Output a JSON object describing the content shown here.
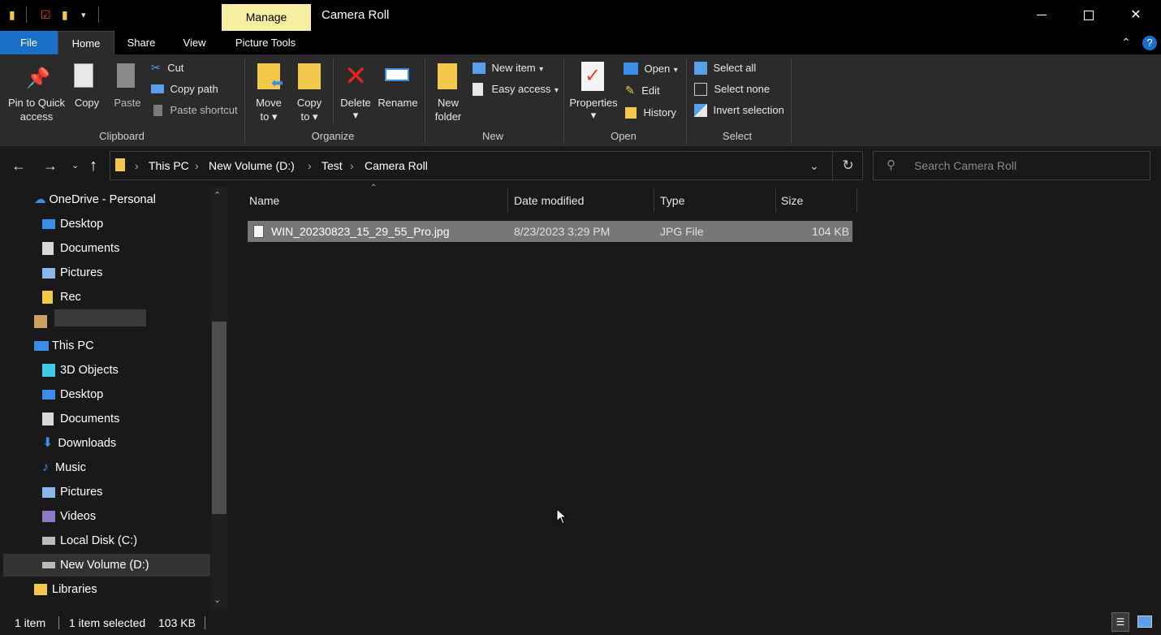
{
  "window": {
    "title": "Camera Roll",
    "manage_tab": "Manage",
    "minimize": "—",
    "maximize": "☐",
    "close": "✕"
  },
  "tabs": {
    "file": "File",
    "home": "Home",
    "share": "Share",
    "view": "View",
    "picture_tools": "Picture Tools"
  },
  "ribbon": {
    "clipboard": {
      "pin": "Pin to Quick access",
      "pin_line1": "Pin to Quick",
      "pin_line2": "access",
      "copy": "Copy",
      "paste": "Paste",
      "cut": "Cut",
      "copy_path": "Copy path",
      "paste_shortcut": "Paste shortcut",
      "label": "Clipboard"
    },
    "organize": {
      "move_to": "Move",
      "move_to2": "to",
      "copy_to": "Copy",
      "copy_to2": "to",
      "delete": "Delete",
      "rename": "Rename",
      "label": "Organize"
    },
    "new": {
      "new_folder1": "New",
      "new_folder2": "folder",
      "new_item": "New item",
      "easy_access": "Easy access",
      "label": "New"
    },
    "open": {
      "properties": "Properties",
      "open": "Open",
      "edit": "Edit",
      "history": "History",
      "label": "Open"
    },
    "select": {
      "select_all": "Select all",
      "select_none": "Select none",
      "invert": "Invert selection",
      "label": "Select"
    }
  },
  "address": {
    "crumbs": [
      "This PC",
      "New Volume (D:)",
      "Test",
      "Camera Roll"
    ],
    "search_placeholder": "Search Camera Roll"
  },
  "nav": {
    "onedrive": "OneDrive - Personal",
    "od_items": [
      "Desktop",
      "Documents",
      "Pictures",
      "Rec"
    ],
    "this_pc": "This PC",
    "pc_items": [
      "3D Objects",
      "Desktop",
      "Documents",
      "Downloads",
      "Music",
      "Pictures",
      "Videos",
      "Local Disk (C:)",
      "New Volume (D:)"
    ],
    "libraries": "Libraries"
  },
  "columns": {
    "name": "Name",
    "date": "Date modified",
    "type": "Type",
    "size": "Size"
  },
  "files": [
    {
      "name": "WIN_20230823_15_29_55_Pro.jpg",
      "date": "8/23/2023 3:29 PM",
      "type": "JPG File",
      "size": "104 KB"
    }
  ],
  "status": {
    "count": "1 item",
    "selected": "1 item selected",
    "sel_size": "103 KB"
  },
  "colors": {
    "file_tab": "#1a6fc9",
    "manage_tab": "#f6eea0",
    "selection": "#777777"
  }
}
